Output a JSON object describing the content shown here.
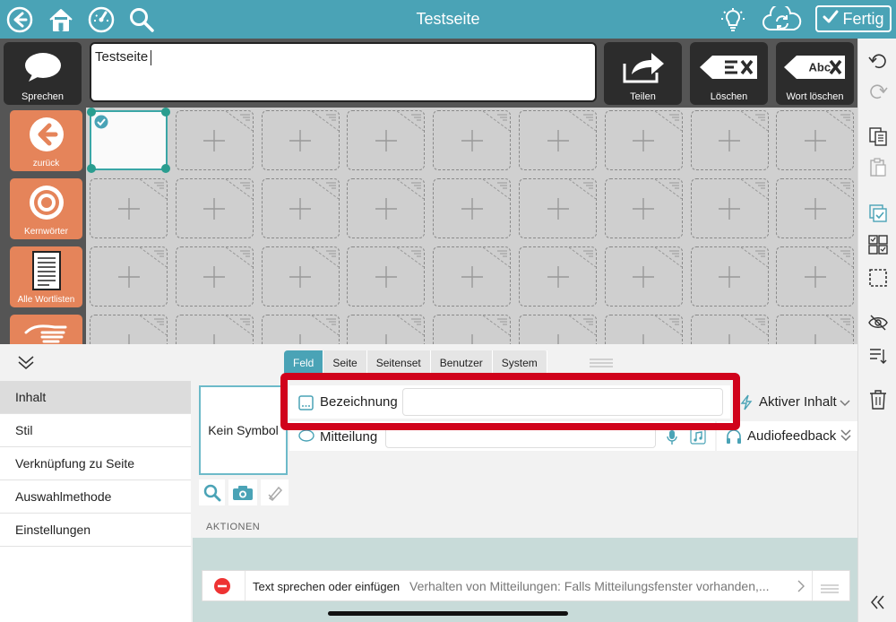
{
  "app": {
    "title": "Testseite",
    "done_label": "Fertig",
    "accent_color": "#4aa3b6"
  },
  "toolbar_left_icons": [
    "back-circle-icon",
    "home-icon",
    "dashboard-icon",
    "search-icon"
  ],
  "toolbar_right_icons": [
    "lightbulb-icon",
    "cloud-sync-icon"
  ],
  "message_bar": {
    "speak_label": "Sprechen",
    "text": "Testseite",
    "share_label": "Teilen",
    "delete_label": "Löschen",
    "delete_word_label": "Wort löschen",
    "delete_word_icon_text": "Abc"
  },
  "left_buttons": [
    {
      "label": "zurück",
      "icon": "arrow-left-circle-icon"
    },
    {
      "label": "Kernwörter",
      "icon": "target-icon"
    },
    {
      "label": "Alle Wortlisten",
      "icon": "document-list-icon"
    },
    {
      "label": "",
      "icon": "hand-icon"
    }
  ],
  "grid": {
    "rows": 4,
    "cols": 9
  },
  "editor": {
    "tabs": [
      "Feld",
      "Seite",
      "Seitenset",
      "Benutzer",
      "System"
    ],
    "active_tab": "Feld",
    "side_menu": [
      "Inhalt",
      "Stil",
      "Verknüpfung zu Seite",
      "Auswahlmethode",
      "Einstellungen"
    ],
    "active_side_item": "Inhalt",
    "symbol_placeholder": "Kein Symbol",
    "label_field": "Bezeichnung",
    "label_value": "",
    "message_field": "Mitteilung",
    "message_value": "",
    "active_content": "Aktiver Inhalt",
    "audio_feedback": "Audiofeedback",
    "actions_header": "AKTIONEN",
    "action_name": "Text sprechen oder einfügen",
    "action_desc": "Verhalten von Mitteilungen: Falls Mitteilungsfenster vorhanden,..."
  },
  "right_sidebar_icons": [
    "undo-icon",
    "redo-icon",
    "copy-icon",
    "paste-icon",
    "select-icon",
    "multi-select-icon",
    "marquee-select-icon",
    "hide-icon",
    "sort-icon",
    "trash-icon",
    "collapse-icon"
  ]
}
